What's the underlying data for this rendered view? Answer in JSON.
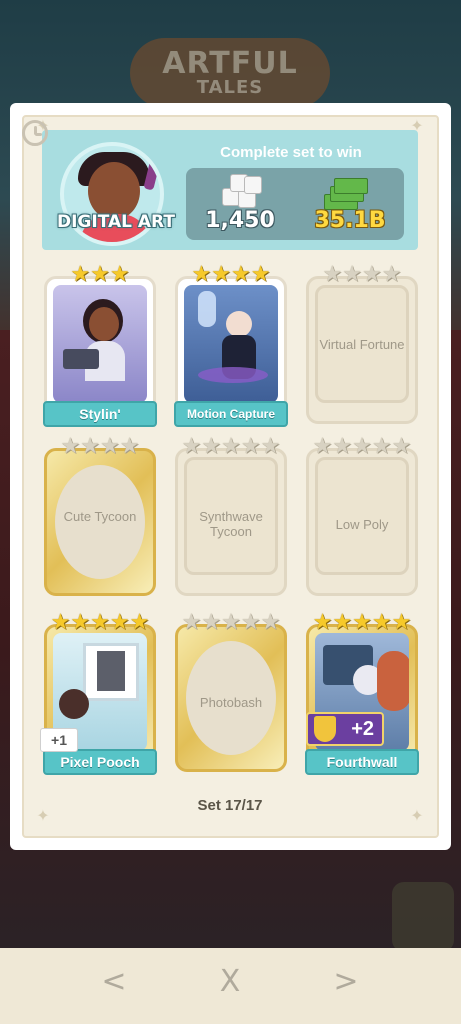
{
  "background": {
    "title_line1": "ARTFUL",
    "title_line2": "TALES"
  },
  "header": {
    "set_name": "DIGITAL ART",
    "caption": "Complete set to win",
    "reward_dice": "1,450",
    "reward_cash": "35.1B"
  },
  "cards": [
    {
      "name": "Stylin'",
      "stars": 3,
      "state": "owned"
    },
    {
      "name": "Motion Capture",
      "stars": 4,
      "state": "owned"
    },
    {
      "name": "Virtual Fortune",
      "stars": 4,
      "state": "missing"
    },
    {
      "name": "Cute Tycoon",
      "stars": 4,
      "state": "missing-gold"
    },
    {
      "name": "Synthwave Tycoon",
      "stars": 5,
      "state": "missing"
    },
    {
      "name": "Low Poly",
      "stars": 5,
      "state": "missing"
    },
    {
      "name": "Pixel Pooch",
      "stars": 5,
      "state": "owned-gold",
      "extra": "+1"
    },
    {
      "name": "Photobash",
      "stars": 5,
      "state": "missing-gold"
    },
    {
      "name": "Fourthwall",
      "stars": 5,
      "state": "owned-gold",
      "extra": "+2"
    }
  ],
  "progress": "Set 17/17",
  "nav": {
    "prev": "<",
    "close": "X",
    "next": ">"
  },
  "colors": {
    "banner": "#57c4c7",
    "header": "#a8dde0",
    "gold": "#e2bf57",
    "star": "#f6c92a"
  }
}
